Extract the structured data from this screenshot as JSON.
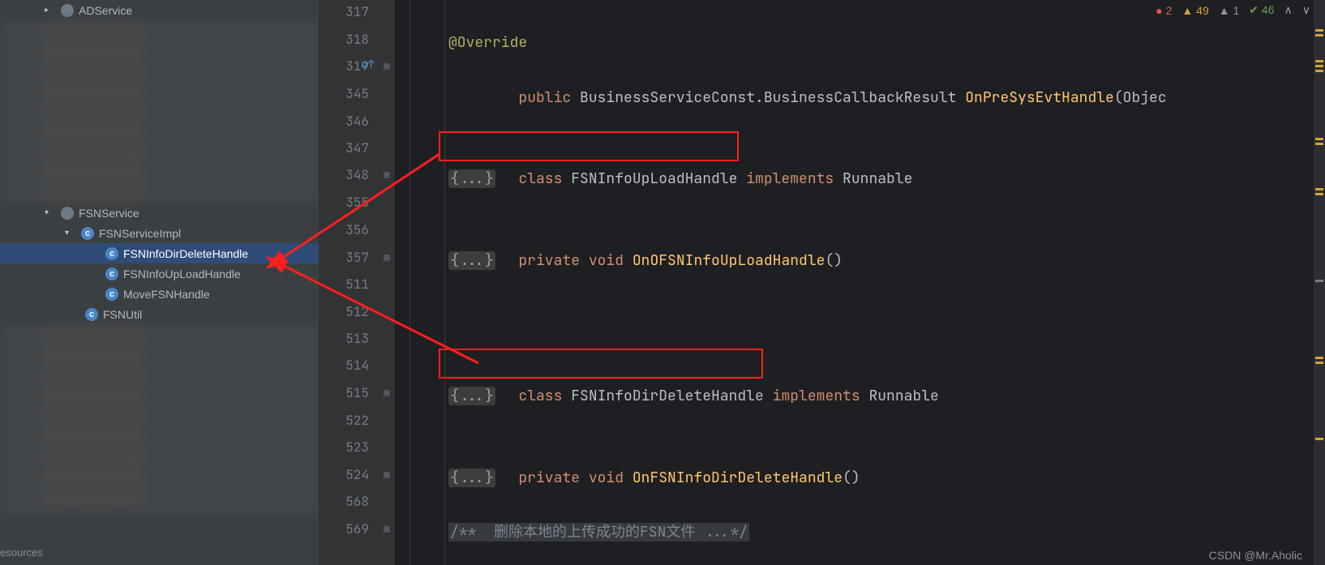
{
  "sidebar": {
    "top": {
      "label": "ADService"
    },
    "folder": {
      "label": "FSNService"
    },
    "impl": {
      "label": "FSNServiceImpl"
    },
    "children": [
      {
        "label": "FSNInfoDirDeleteHandle"
      },
      {
        "label": "FSNInfoUpLoadHandle"
      },
      {
        "label": "MoveFSNHandle"
      }
    ],
    "util": {
      "label": "FSNUtil"
    },
    "resources": "esources"
  },
  "inspections": {
    "errors": "2",
    "warnings": "49",
    "weak": "1",
    "ok": "46"
  },
  "gutter": {
    "lines": [
      "317",
      "318",
      "319",
      "345",
      "346",
      "347",
      "348",
      "355",
      "356",
      "357",
      "511",
      "512",
      "513",
      "514",
      "515",
      "522",
      "523",
      "524",
      "568",
      "569"
    ]
  },
  "code": {
    "l318": {
      "a": "@Override"
    },
    "l319": {
      "k1": "public",
      "t": "BusinessServiceConst.BusinessCallbackResult",
      "m": "OnPreSysEvtHandle",
      "p": "(Objec"
    },
    "l347": {
      "k1": "class",
      "n": "FSNInfoUpLoadHandle",
      "k2": "implements",
      "t": "Runnable"
    },
    "l348": {
      "c": "{...}"
    },
    "l356": {
      "k1": "private",
      "k2": "void",
      "m": "OnOFSNInfoUpLoadHandle",
      "p": "()"
    },
    "l357": {
      "c": "{...}"
    },
    "l514": {
      "k1": "class",
      "n": "FSNInfoDirDeleteHandle",
      "k2": "implements",
      "t": "Runnable"
    },
    "l515": {
      "c": "{...}"
    },
    "l523": {
      "k1": "private",
      "k2": "void",
      "m": "OnFSNInfoDirDeleteHandle",
      "p": "()"
    },
    "l524": {
      "c": "{...}"
    },
    "l569": {
      "c": "/**  删除本地的上传成功的FSN文件 ...*/"
    }
  },
  "watermark": "CSDN @Mr.Aholic"
}
